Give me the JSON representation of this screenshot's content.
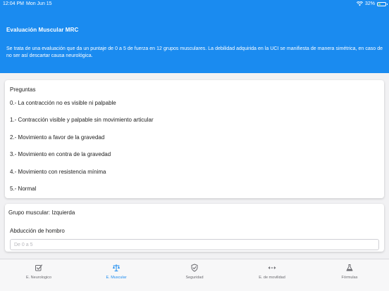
{
  "status_bar": {
    "time": "12:04 PM",
    "date": "Mon Jun 15",
    "battery": "32%",
    "battery_level": 0.32
  },
  "header": {
    "title": "Evaluación Muscular MRC",
    "description": "Se trata de una evaluación que da un puntaje de 0 a 5 de fuerza en 12 grupos musculares.  La debilidad adquirida en la UCI se manifiesta de manera simétrica, en caso de no ser así descartar causa neurológica."
  },
  "questions": {
    "title": "Preguntas",
    "options": [
      "0.- La contracción no es visible ni palpable",
      "1.- Contracción visible y palpable sin movimiento articular",
      "2.- Movimiento a favor de la gravedad",
      "3.- Movimiento en contra de la gravedad",
      "4.- Movimiento con resistencia mínima",
      "5.- Normal"
    ]
  },
  "group": {
    "label": "Grupo muscular: Izquierda",
    "muscle": "Abducción de hombro",
    "input_placeholder": "De 0 a 5",
    "input_value": ""
  },
  "tabs": [
    {
      "label": "E. Neurologico",
      "icon": "checkbox-icon",
      "active": false
    },
    {
      "label": "E. Muscular",
      "icon": "scale-icon",
      "active": true
    },
    {
      "label": "Seguridad",
      "icon": "shield-check-icon",
      "active": false
    },
    {
      "label": "E. de movilidad",
      "icon": "arrows-icon",
      "active": false
    },
    {
      "label": "Fórmulas",
      "icon": "flask-icon",
      "active": false
    }
  ],
  "colors": {
    "accent": "#1a8bf0",
    "inactive_tab": "#6b6b70",
    "battery_fill": "#9be55c"
  }
}
